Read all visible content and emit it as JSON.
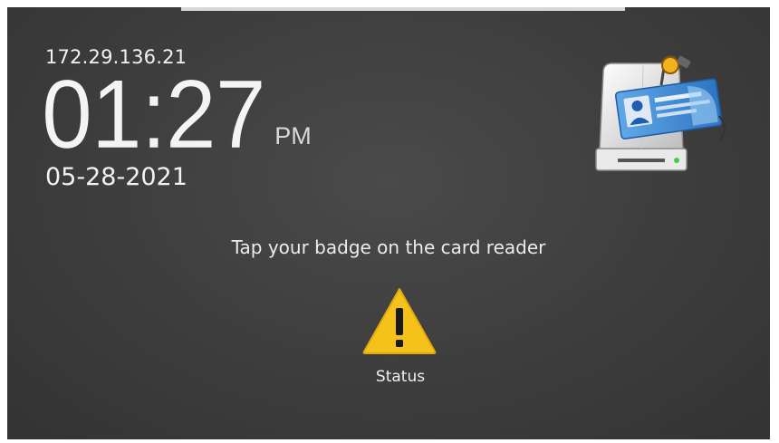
{
  "ip_address": "172.29.136.21",
  "clock": {
    "time": "01:27",
    "ampm": "PM",
    "date": "05-28-2021"
  },
  "card_reader_icon": "card-reader-icon",
  "prompt": "Tap your badge on the card reader",
  "status": {
    "icon": "warning-icon",
    "label": "Status",
    "color": "#f5c21b"
  }
}
